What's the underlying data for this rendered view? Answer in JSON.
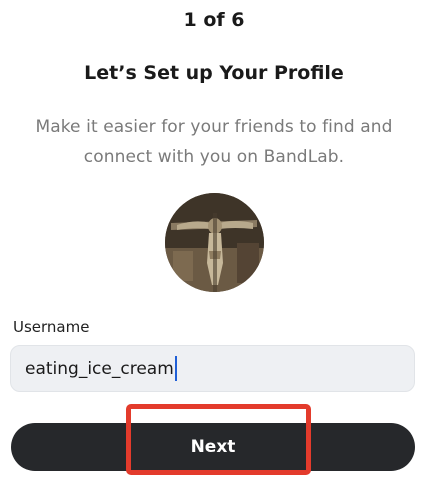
{
  "header": {
    "step_indicator": "1 of 6",
    "title": "Let’s Set up Your Profile",
    "subtitle": "Make it easier for your friends to find and connect with you on BandLab."
  },
  "profile": {
    "avatar_icon": "profile-photo"
  },
  "form": {
    "username_label": "Username",
    "username_value": "eating_ice_cream"
  },
  "actions": {
    "next_label": "Next"
  },
  "colors": {
    "button_bg": "#26282b",
    "input_bg": "#eef0f3",
    "caret": "#1f5fd6",
    "highlight": "#e33b2c",
    "subtitle_text": "#7a7a7a"
  }
}
